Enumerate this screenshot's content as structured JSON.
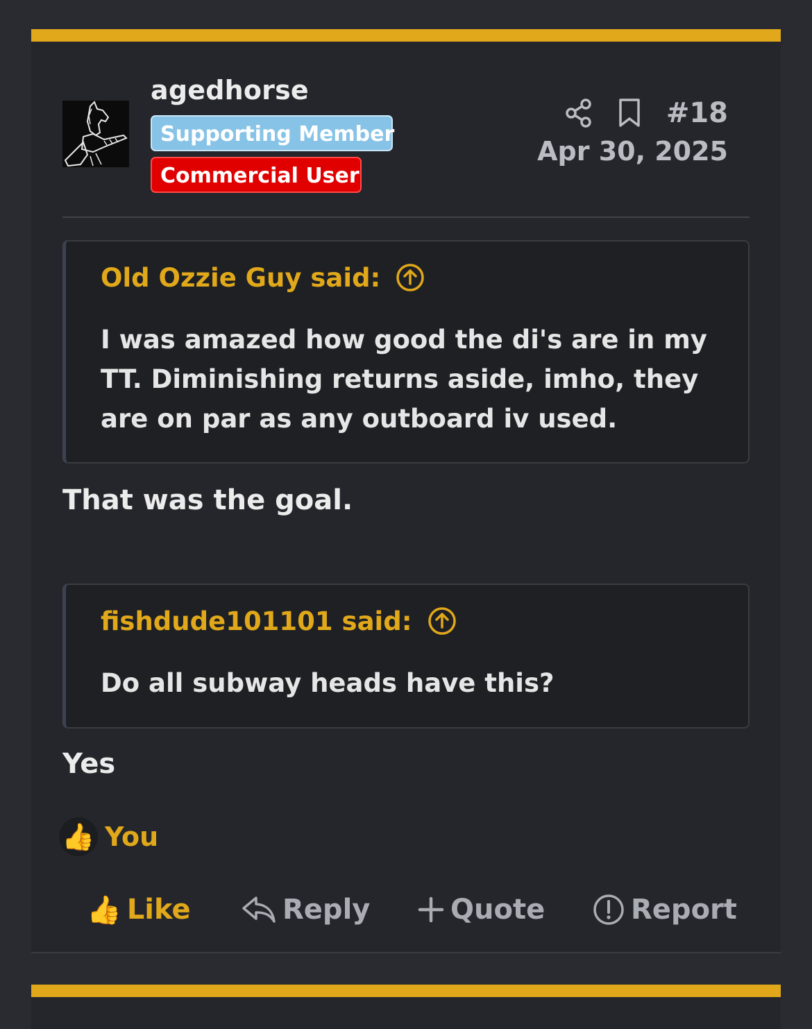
{
  "post": {
    "username": "agedhorse",
    "badges": {
      "supporting": "Supporting Member",
      "commercial": "Commercial User"
    },
    "post_number": "#18",
    "date": "Apr 30, 2025",
    "icons": [
      "share-icon",
      "bookmark-icon",
      "avatar-horse-image"
    ]
  },
  "quotes": [
    {
      "author": "Old Ozzie Guy said:",
      "body": "I was amazed how good the di's are in my TT. Diminishing returns aside, imho, they are on par as any outboard iv used."
    },
    {
      "author": "fishdude101101 said:",
      "body": "Do all subway heads have this?"
    }
  ],
  "replies": [
    "That was the goal.",
    "Yes"
  ],
  "reactions": {
    "emoji": "👍",
    "label": "You"
  },
  "actions": {
    "like": "Like",
    "reply": "Reply",
    "quote": "Quote",
    "report": "Report"
  },
  "colors": {
    "accent": "#e0a81a",
    "background": "#25262b",
    "badge_supporting": "#86c3e6",
    "badge_commercial": "#e00000"
  }
}
